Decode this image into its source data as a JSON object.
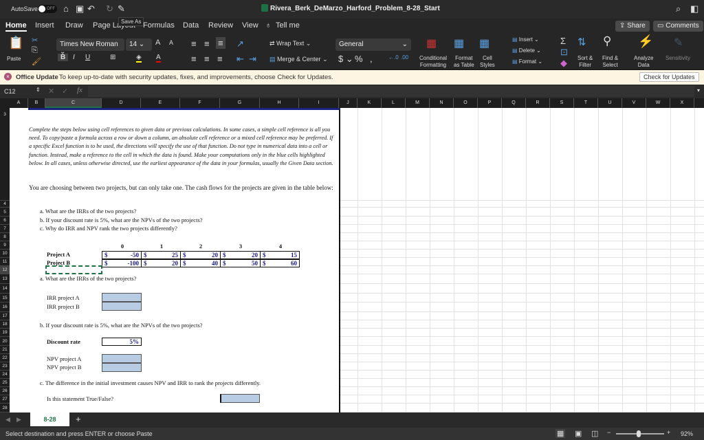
{
  "titlebar": {
    "autosave": "AutoSave",
    "autosave_state": "OFF",
    "title": "Rivera_Berk_DeMarzo_Harford_Problem_8-28_Start",
    "tooltip": "Save As"
  },
  "tabs": [
    "Home",
    "Insert",
    "Draw",
    "Page Layout",
    "Formulas",
    "Data",
    "Review",
    "View"
  ],
  "tell_me": "Tell me",
  "share": "Share",
  "comments": "Comments",
  "ribbon": {
    "paste": "Paste",
    "font_name": "Times New Roman",
    "font_size": "14",
    "wrap_text": "Wrap Text",
    "merge_center": "Merge & Center",
    "number_format": "General",
    "conditional": [
      "Conditional",
      "Formatting"
    ],
    "format_table": [
      "Format",
      "as Table"
    ],
    "cell_styles": [
      "Cell",
      "Styles"
    ],
    "insert": "Insert",
    "delete": "Delete",
    "format": "Format",
    "sort": [
      "Sort &",
      "Filter"
    ],
    "find": [
      "Find &",
      "Select"
    ],
    "analyze": [
      "Analyze",
      "Data"
    ],
    "sensitivity": "Sensitivity",
    "accent": "#1f77d4"
  },
  "update": {
    "title": "Office Update",
    "message": "To keep up-to-date with security updates, fixes, and improvements, choose Check for Updates.",
    "button": "Check for Updates"
  },
  "formula": {
    "name_box": "C12",
    "fx": "fx",
    "value": ""
  },
  "columns": [
    "A",
    "B",
    "C",
    "D",
    "E",
    "F",
    "G",
    "H",
    "I",
    "J",
    "K",
    "L",
    "M",
    "N",
    "O",
    "P",
    "Q",
    "R",
    "S",
    "T",
    "U",
    "V",
    "W",
    "X"
  ],
  "rows": [
    "3",
    "4",
    "5",
    "6",
    "7",
    "8",
    "9",
    "10",
    "11",
    "12",
    "13",
    "14",
    "15",
    "16",
    "17",
    "18",
    "19",
    "20",
    "21",
    "22",
    "23",
    "24",
    "25",
    "26",
    "27",
    "28"
  ],
  "sheet": {
    "instructions": "Complete the steps below using cell references to given data or previous calculations. In some cases, a simple cell reference is all you need. To copy/paste a formula across a row or down a column, an absolute cell reference or a mixed cell reference may be preferred. If a specific Excel function is to be used, the directions will specify the use of that function. Do not type in numerical data into a cell or function. Instead, make a reference to the cell in which the data is found. Make your computations only in the blue cells highlighted below. In all cases, unless otherwise directed, use the earliest appearance of the data in your formulas, usually the Given Data section.",
    "intro": "You are choosing between two projects, but can only take one. The cash flows for the projects are given in the table below:",
    "q_a": "a. What are the IRRs of the two projects?",
    "q_b": "b. If your discount rate is 5%, what are the NPVs of the two projects?",
    "q_c": "c. Why do IRR and NPV rank the two projects differently?",
    "years": [
      "0",
      "1",
      "2",
      "3",
      "4"
    ],
    "projects": [
      {
        "name": "Project A",
        "cf": [
          "-50",
          "25",
          "20",
          "20",
          "15"
        ]
      },
      {
        "name": "Project B",
        "cf": [
          "-100",
          "20",
          "40",
          "50",
          "60"
        ]
      }
    ],
    "currency": "$",
    "irr_a": "IRR project A",
    "irr_b": "IRR project B",
    "discount_label": "Discount rate",
    "discount_value": "5%",
    "npv_a": "NPV project A",
    "npv_b": "NPV project B",
    "c_statement": "c. The difference in the initial investment causes NPV and IRR to rank the projects differently.",
    "c_question": "Is this statement True/False?",
    "input_color": "#b8cce4"
  },
  "sheet_tab": "8-28",
  "status": {
    "message": "Select destination and press ENTER or choose Paste",
    "zoom": "92%"
  }
}
